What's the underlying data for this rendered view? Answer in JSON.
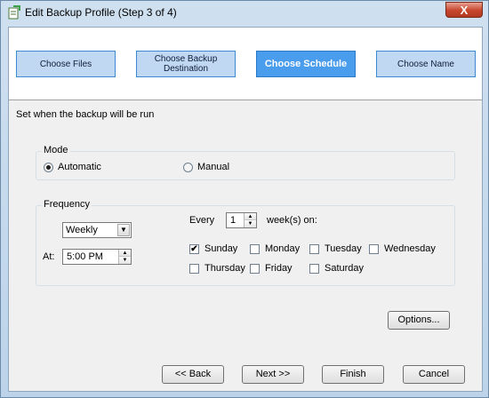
{
  "window": {
    "title": "Edit Backup Profile (Step 3 of 4)",
    "close_glyph": "X"
  },
  "steps": [
    {
      "label": "Choose Files"
    },
    {
      "label": "Choose Backup Destination"
    },
    {
      "label": "Choose Schedule",
      "active": true
    },
    {
      "label": "Choose Name"
    }
  ],
  "instruction": "Set when the backup will be run",
  "mode": {
    "legend": "Mode",
    "options": [
      {
        "label": "Automatic",
        "selected": true
      },
      {
        "label": "Manual",
        "selected": false
      }
    ]
  },
  "frequency": {
    "legend": "Frequency",
    "period": "Weekly",
    "at_label": "At:",
    "time": "5:00 PM",
    "every_label": "Every",
    "every_value": "1",
    "weeks_on_label": "week(s) on:",
    "days": [
      {
        "label": "Sunday",
        "checked": true
      },
      {
        "label": "Monday",
        "checked": false
      },
      {
        "label": "Tuesday",
        "checked": false
      },
      {
        "label": "Wednesday",
        "checked": false
      },
      {
        "label": "Thursday",
        "checked": false
      },
      {
        "label": "Friday",
        "checked": false
      },
      {
        "label": "Saturday",
        "checked": false
      }
    ]
  },
  "buttons": {
    "options": "Options...",
    "back": "<< Back",
    "next": "Next >>",
    "finish": "Finish",
    "cancel": "Cancel"
  },
  "colors": {
    "active_step": "#4a9cec",
    "step": "#c1d8f2",
    "close_button": "#c7452d"
  }
}
